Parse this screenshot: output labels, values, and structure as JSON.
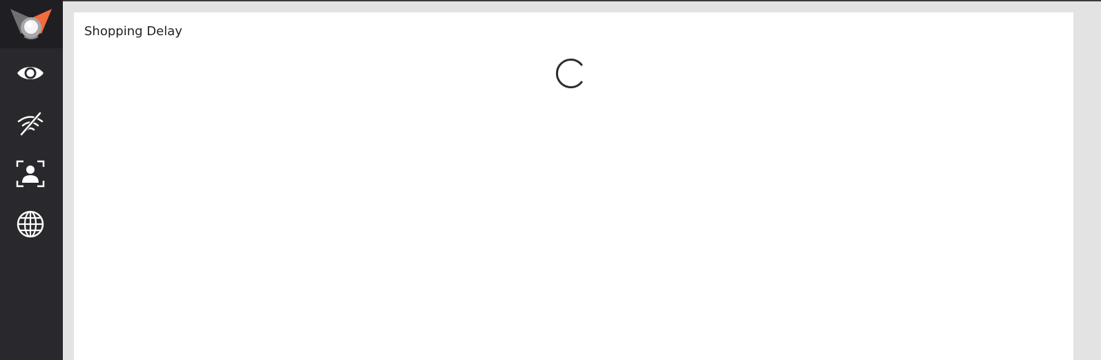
{
  "app": {
    "logo_name": "fox-logo",
    "accent_color": "#f26c3d",
    "sidebar_color": "#28282d"
  },
  "sidebar": {
    "items": [
      {
        "icon": "eye-icon"
      },
      {
        "icon": "wifi-off-icon"
      },
      {
        "icon": "user-scan-icon"
      },
      {
        "icon": "globe-icon"
      }
    ]
  },
  "main": {
    "title": "Shopping Delay",
    "loading_indicator": "spinner-icon"
  }
}
